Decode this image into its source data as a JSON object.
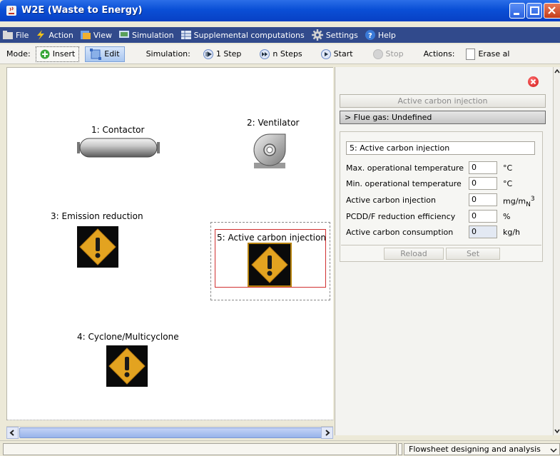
{
  "window": {
    "title": "W2E (Waste to Energy)"
  },
  "menu": [
    {
      "label": "File",
      "icon": "folder-icon"
    },
    {
      "label": "Action",
      "icon": "lightning-icon"
    },
    {
      "label": "View",
      "icon": "view-icon"
    },
    {
      "label": "Simulation",
      "icon": "monitor-icon"
    },
    {
      "label": "Supplemental computations",
      "icon": "grid-icon"
    },
    {
      "label": "Settings",
      "icon": "gear-icon"
    },
    {
      "label": "Help",
      "icon": "help-icon"
    }
  ],
  "toolbar": {
    "mode_label": "Mode:",
    "insert": "Insert",
    "edit": "Edit",
    "simulation_label": "Simulation:",
    "step1": "1 Step",
    "nsteps": "n Steps",
    "start": "Start",
    "stop": "Stop",
    "actions_label": "Actions:",
    "erase": "Erase al"
  },
  "canvas": {
    "nodes": [
      {
        "label": "1: Contactor",
        "icon": "contactor-icon"
      },
      {
        "label": "2: Ventilator",
        "icon": "ventilator-icon"
      },
      {
        "label": "3: Emission reduction",
        "icon": "warning-icon"
      },
      {
        "label": "4: Cyclone/Multicyclone",
        "icon": "warning-icon"
      },
      {
        "label": "5: Active carbon injection",
        "icon": "warning-icon",
        "selected": true
      }
    ]
  },
  "panel": {
    "title": "Active carbon injection",
    "flue_gas": "> Flue gas: Undefined",
    "name": "5: Active carbon injection",
    "properties": [
      {
        "label": "Max. operational temperature",
        "value": "0",
        "unit": "°C"
      },
      {
        "label": "Min. operational temperature",
        "value": "0",
        "unit": "°C"
      },
      {
        "label": "Active carbon injection",
        "value": "0",
        "unit_base": "mg/m",
        "unit_sub": "N",
        "unit_sup": "3"
      },
      {
        "label": "PCDD/F reduction efficiency",
        "value": "0",
        "unit": "%"
      },
      {
        "label": "Active carbon consumption",
        "value": "0",
        "unit": "kg/h",
        "readonly": true
      }
    ],
    "reload": "Reload",
    "set": "Set"
  },
  "status": {
    "mode": "Flowsheet designing and analysis"
  },
  "colors": {
    "titlebar": "#0a4fd6",
    "menubar": "#314a8c",
    "warning": "#e3a320",
    "selection": "#d03030"
  }
}
